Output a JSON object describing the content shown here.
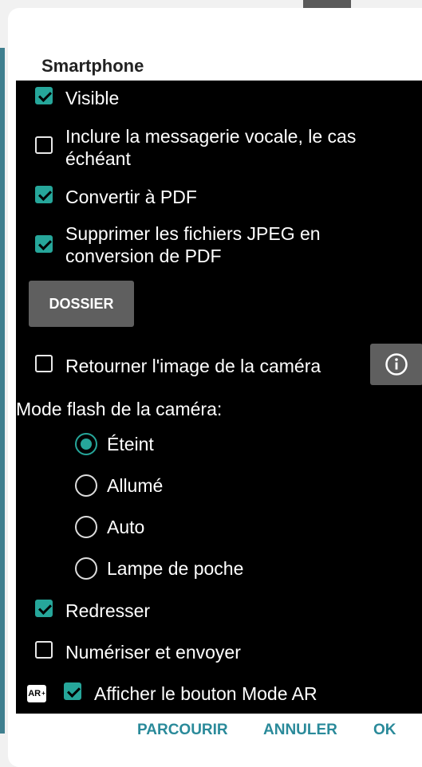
{
  "dialog": {
    "title": "Smartphone",
    "options": {
      "visible": {
        "label": "Visible",
        "checked": true
      },
      "voicemail": {
        "label": "Inclure la messagerie vocale, le cas échéant",
        "checked": false
      },
      "pdf": {
        "label": "Convertir à PDF",
        "checked": true
      },
      "delete_jpeg": {
        "label": "Supprimer les fichiers JPEG en conversion de PDF",
        "checked": true
      },
      "flip": {
        "label": "Retourner l'image de la caméra",
        "checked": false
      },
      "straighten": {
        "label": "Redresser",
        "checked": true
      },
      "scan_send": {
        "label": "Numériser et envoyer",
        "checked": false
      },
      "ar_button": {
        "label": "Afficher le bouton Mode AR",
        "checked": true
      }
    },
    "folder_button": "DOSSIER",
    "flash": {
      "label": "Mode flash de la caméra:",
      "options": [
        "Éteint",
        "Allumé",
        "Auto",
        "Lampe de poche"
      ],
      "selected": "Éteint"
    },
    "ar_badge": "AR",
    "ar_badge_sup": "+",
    "footer": {
      "browse": "PARCOURIR",
      "cancel": "ANNULER",
      "ok": "OK"
    },
    "accent_color": "#26a69a",
    "link_color": "#2a8a9a",
    "info_icon": "info-icon"
  }
}
